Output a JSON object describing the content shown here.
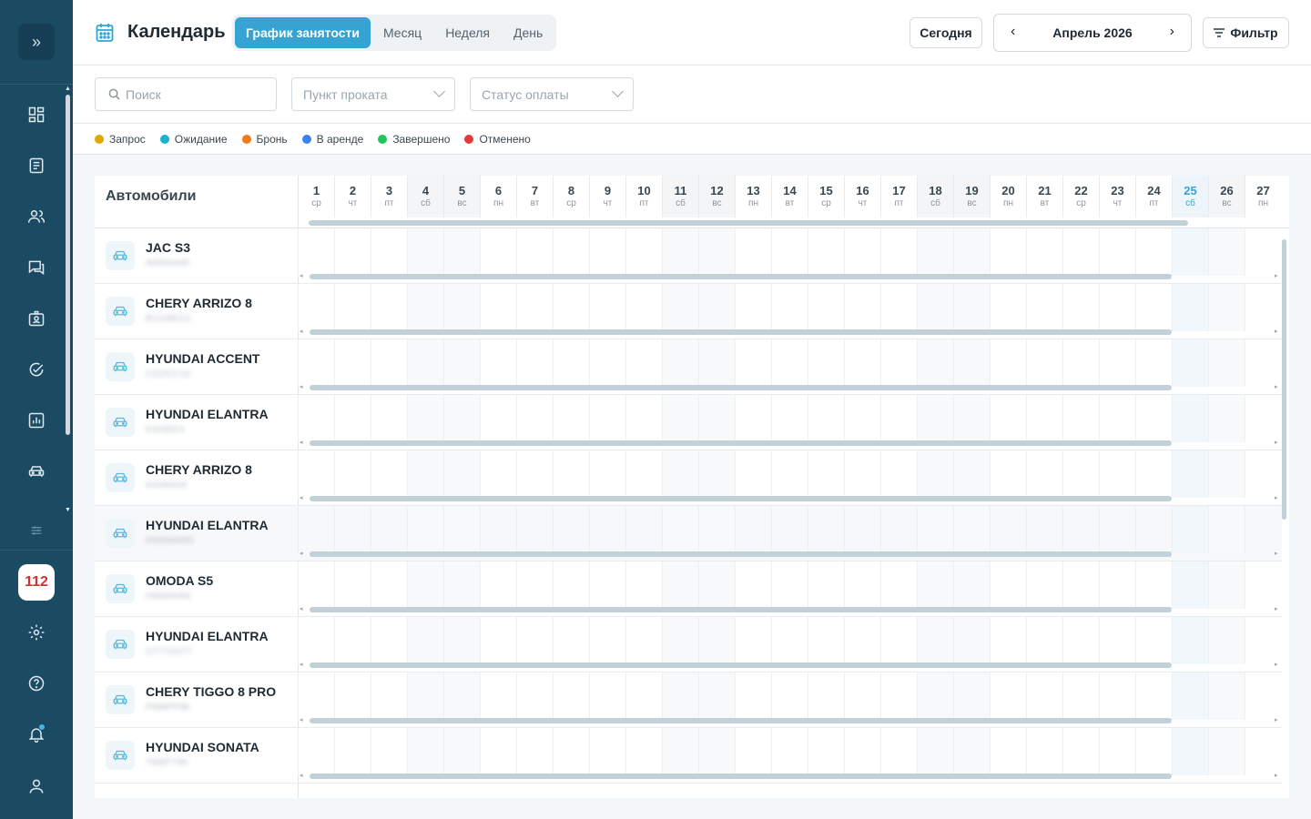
{
  "sidebar": {
    "toggle_icon": "chevrons-right-icon",
    "items": [
      {
        "icon": "dashboard-icon"
      },
      {
        "icon": "list-icon"
      },
      {
        "icon": "users-icon"
      },
      {
        "icon": "chat-icon"
      },
      {
        "icon": "id-card-icon"
      },
      {
        "icon": "check-circle-icon"
      },
      {
        "icon": "chart-icon"
      },
      {
        "icon": "car-icon"
      }
    ],
    "bottom": {
      "settings_sliders_icon": "sliders-icon",
      "badge": "112",
      "gear_icon": "gear-icon",
      "help_icon": "help-icon",
      "bell_icon": "bell-icon",
      "user_icon": "user-icon"
    }
  },
  "header": {
    "title": "Календарь",
    "tabs": [
      {
        "label": "График занятости",
        "active": true
      },
      {
        "label": "Месяц",
        "active": false
      },
      {
        "label": "Неделя",
        "active": false
      },
      {
        "label": "День",
        "active": false
      }
    ],
    "today_label": "Сегодня",
    "month_label": "Апрель 2026",
    "filter_label": "Фильтр"
  },
  "filters": {
    "search_placeholder": "Поиск",
    "point_placeholder": "Пункт проката",
    "payment_placeholder": "Статус оплаты"
  },
  "legend": [
    {
      "label": "Запрос",
      "color": "#e0a800"
    },
    {
      "label": "Ожидание",
      "color": "#17b3cf"
    },
    {
      "label": "Бронь",
      "color": "#f07a1a"
    },
    {
      "label": "В аренде",
      "color": "#3b82f6"
    },
    {
      "label": "Завершено",
      "color": "#22c55e"
    },
    {
      "label": "Отменено",
      "color": "#e53935"
    }
  ],
  "grid": {
    "column_title": "Автомобили",
    "today_day": 25,
    "days": [
      {
        "n": "1",
        "w": "ср"
      },
      {
        "n": "2",
        "w": "чт"
      },
      {
        "n": "3",
        "w": "пт"
      },
      {
        "n": "4",
        "w": "сб"
      },
      {
        "n": "5",
        "w": "вс"
      },
      {
        "n": "6",
        "w": "пн"
      },
      {
        "n": "7",
        "w": "вт"
      },
      {
        "n": "8",
        "w": "ср"
      },
      {
        "n": "9",
        "w": "чт"
      },
      {
        "n": "10",
        "w": "пт"
      },
      {
        "n": "11",
        "w": "сб"
      },
      {
        "n": "12",
        "w": "вс"
      },
      {
        "n": "13",
        "w": "пн"
      },
      {
        "n": "14",
        "w": "вт"
      },
      {
        "n": "15",
        "w": "ср"
      },
      {
        "n": "16",
        "w": "чт"
      },
      {
        "n": "17",
        "w": "пт"
      },
      {
        "n": "18",
        "w": "сб"
      },
      {
        "n": "19",
        "w": "вс"
      },
      {
        "n": "20",
        "w": "пн"
      },
      {
        "n": "21",
        "w": "вт"
      },
      {
        "n": "22",
        "w": "ср"
      },
      {
        "n": "23",
        "w": "чт"
      },
      {
        "n": "24",
        "w": "пт"
      },
      {
        "n": "25",
        "w": "сб"
      },
      {
        "n": "26",
        "w": "вс"
      },
      {
        "n": "27",
        "w": "пн"
      }
    ],
    "cars": [
      {
        "name": "JAC S3",
        "plate": "А000АА00"
      },
      {
        "name": "CHERY ARRIZO 8",
        "plate": "В111ВВ111"
      },
      {
        "name": "HYUNDAI ACCENT",
        "plate": "С222СС22"
      },
      {
        "name": "HYUNDAI ELANTRA",
        "plate": "Е333ЕЕ3"
      },
      {
        "name": "CHERY ARRIZO 8",
        "plate": "К444КК44"
      },
      {
        "name": "HYUNDAI ELANTRA",
        "plate": "М555ММ55",
        "highlight": true
      },
      {
        "name": "OMODA S5",
        "plate": "Н666НН66"
      },
      {
        "name": "HYUNDAI ELANTRA",
        "plate": "О777ОО77"
      },
      {
        "name": "CHERY TIGGO 8 PRO",
        "plate": "Р888РР88"
      },
      {
        "name": "HYUNDAI SONATA",
        "plate": "Т999ТТ99"
      }
    ]
  }
}
